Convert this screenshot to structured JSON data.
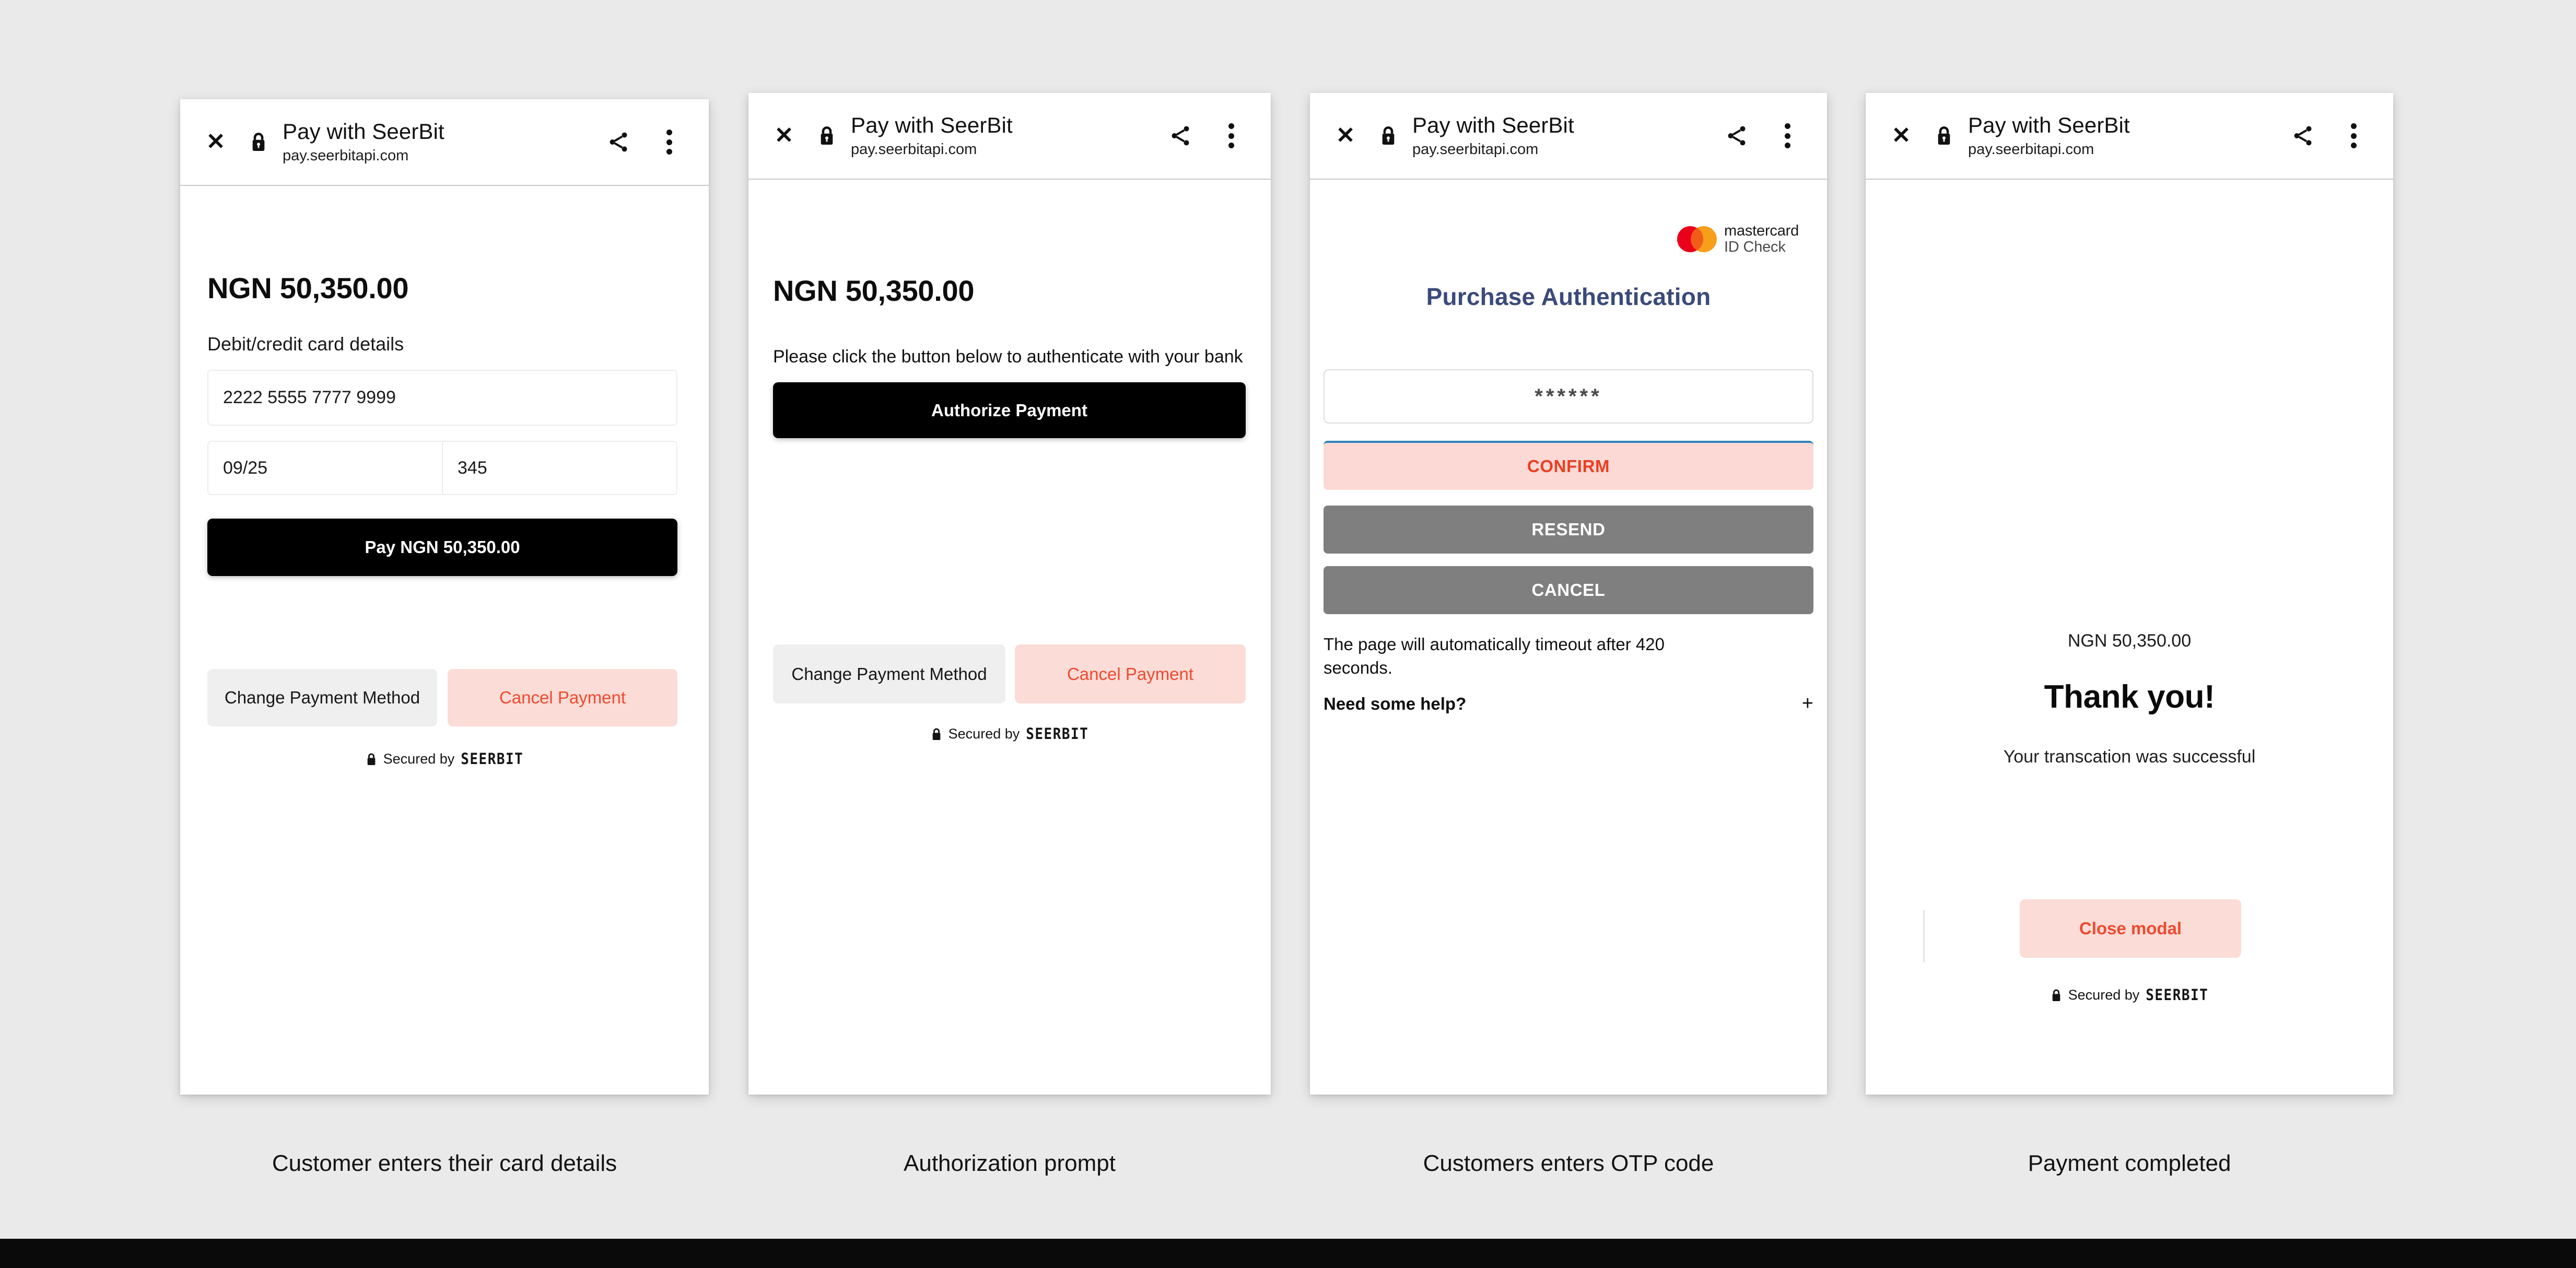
{
  "browser": {
    "title": "Pay with SeerBit",
    "url": "pay.seerbitapi.com",
    "close_icon": "close-icon",
    "lock_icon": "lock-icon",
    "share_icon": "share-icon",
    "menu_icon": "more-vertical-icon"
  },
  "colors": {
    "page_background": "#eaeaea",
    "panel_background": "#ffffff",
    "primary_button": "#000000",
    "danger_text": "#ef4a30",
    "danger_surface": "#fcdcd6",
    "neutral_surface": "#efefef",
    "otp_gray_button": "#7f7f7f",
    "confirm_top_border": "#2b83b8",
    "purchase_title": "#3b4a7a",
    "mastercard_red": "#eb001b",
    "mastercard_yellow": "#f79e1b",
    "mastercard_overlap": "#f15c19"
  },
  "secured": {
    "lock_icon": "lock-icon",
    "text": "Secured by",
    "brand": "SEERBIT"
  },
  "panel1": {
    "caption": "Customer enters their card details",
    "amount": "NGN 50,350.00",
    "section_label": "Debit/credit card details",
    "card_number": "2222 5555 7777 9999",
    "expiry": "09/25",
    "cvv": "345",
    "pay_button": "Pay NGN 50,350.00",
    "change_method_button": "Change Payment Method",
    "cancel_button": "Cancel Payment"
  },
  "panel2": {
    "caption": "Authorization prompt",
    "amount": "NGN 50,350.00",
    "instruction": "Please click the button below to authenticate with your bank",
    "authorize_button": "Authorize Payment",
    "change_method_button": "Change Payment Method",
    "cancel_button": "Cancel Payment"
  },
  "panel3": {
    "caption": "Customers enters OTP code",
    "brand_line1": "mastercard",
    "brand_line2": "ID Check",
    "title": "Purchase Authentication",
    "otp_value": "******",
    "confirm_button": "CONFIRM",
    "resend_button": "RESEND",
    "cancel_button": "CANCEL",
    "timeout_text": "The page will automatically timeout after 420 seconds.",
    "help_label": "Need some help?",
    "help_expand_icon": "plus-icon"
  },
  "panel4": {
    "caption": "Payment completed",
    "amount": "NGN  50,350.00",
    "title": "Thank you!",
    "subtitle": "Your transcation was successful",
    "close_button": "Close modal"
  }
}
